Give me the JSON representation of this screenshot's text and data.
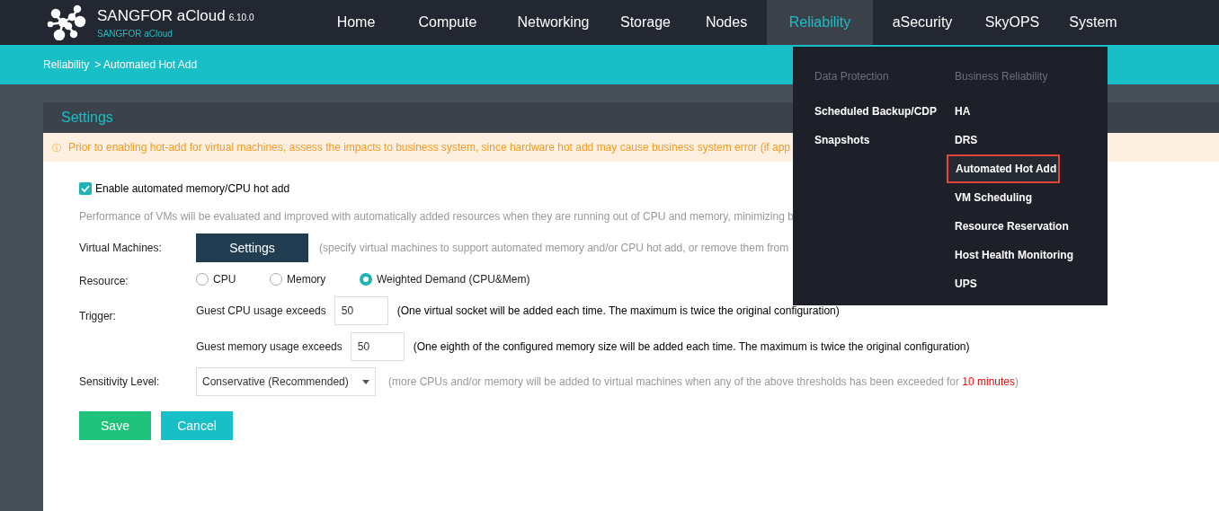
{
  "brand": {
    "title": "SANGFOR aCloud",
    "version": "6.10.0",
    "subtitle": "SANGFOR aCloud"
  },
  "nav": [
    {
      "label": "Home",
      "selected": false
    },
    {
      "label": "Compute",
      "selected": false
    },
    {
      "label": "Networking",
      "selected": false
    },
    {
      "label": "Storage",
      "selected": false
    },
    {
      "label": "Nodes",
      "selected": false
    },
    {
      "label": "Reliability",
      "selected": true
    },
    {
      "label": "aSecurity",
      "selected": false
    },
    {
      "label": "SkyOPS",
      "selected": false
    },
    {
      "label": "System",
      "selected": false
    }
  ],
  "breadcrumb": [
    "Reliability",
    "> Automated Hot Add"
  ],
  "panel_title": "Settings",
  "warning": {
    "icon": "ⓘ",
    "text": "Prior to enabling hot-add for virtual machines, assess the impacts to business system, since hardware hot add may cause business system error (if app"
  },
  "enable": {
    "label": "Enable automated memory/CPU hot add",
    "checked": true
  },
  "description": "Performance of VMs will be evaluated and improved with automatically added resources when they are running out of CPU and memory, minimizing b",
  "virtual_machines": {
    "label": "Virtual Machines:",
    "button": "Settings",
    "hint": "(specify virtual machines to support automated memory and/or CPU hot add, or remove them from"
  },
  "resource": {
    "label": "Resource:",
    "options": [
      {
        "label": "CPU",
        "selected": false
      },
      {
        "label": "Memory",
        "selected": false
      },
      {
        "label": "Weighted Demand (CPU&Mem)",
        "selected": true
      }
    ]
  },
  "trigger": {
    "label": "Trigger:",
    "rows": [
      {
        "label": "Guest CPU usage exceeds",
        "value": "50",
        "note": "(One virtual socket will be added each time. The maximum is twice the original configuration)"
      },
      {
        "label": "Guest memory usage exceeds",
        "value": "50",
        "note": "(One eighth of the configured memory size will be added each time. The maximum is twice the original configuration)"
      }
    ]
  },
  "sensitivity": {
    "label": "Sensitivity Level:",
    "value": "Conservative (Recommended)",
    "note": [
      {
        "kind": "plain",
        "text": "(more CPUs and/or memory will be added to virtual machines when any of the above thresholds has been exceeded for "
      },
      {
        "kind": "highlight",
        "text": "10 minutes"
      },
      {
        "kind": "plain",
        "text": ")"
      }
    ]
  },
  "actions": [
    {
      "kind": "primary",
      "label": "Save"
    },
    {
      "kind": "secondary",
      "label": "Cancel"
    }
  ],
  "menu": {
    "columns": [
      {
        "heading": "Data Protection",
        "items": [
          {
            "label": "Scheduled Backup/CDP",
            "selected": false
          },
          {
            "label": "Snapshots",
            "selected": false
          }
        ]
      },
      {
        "heading": "Business Reliability",
        "items": [
          {
            "label": "HA",
            "selected": false
          },
          {
            "label": "DRS",
            "selected": false
          },
          {
            "label": "Automated Hot Add",
            "selected": true
          },
          {
            "label": "VM Scheduling",
            "selected": false
          },
          {
            "label": "Resource Reservation",
            "selected": false
          },
          {
            "label": "Host Health Monitoring",
            "selected": false
          },
          {
            "label": "UPS",
            "selected": false
          }
        ]
      }
    ]
  }
}
